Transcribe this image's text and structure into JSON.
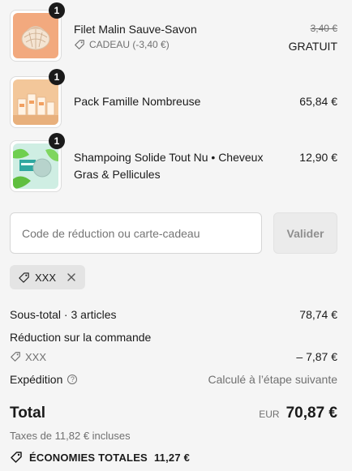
{
  "items": [
    {
      "quantity": "1",
      "name": "Filet Malin Sauve-Savon",
      "discount_label": "CADEAU (-3,40 €)",
      "original_price": "3,40 €",
      "price": "GRATUIT",
      "icon": "tag-icon"
    },
    {
      "quantity": "1",
      "name": "Pack Famille Nombreuse",
      "price": "65,84 €"
    },
    {
      "quantity": "1",
      "name_line1": "Shampoing Solide Tout Nu • Cheveux",
      "name_line2": "Gras & Pellicules",
      "price": "12,90 €"
    }
  ],
  "discount": {
    "placeholder": "Code de réduction ou carte-cadeau",
    "button_label": "Valider",
    "applied_code": "XXX"
  },
  "summary": {
    "subtotal_label": "Sous-total · 3 articles",
    "subtotal_value": "78,74 €",
    "order_discount_label": "Réduction sur la commande",
    "order_discount_code": "XXX",
    "order_discount_value": "– 7,87 €",
    "shipping_label": "Expédition",
    "shipping_value": "Calculé à l’étape suivante",
    "total_label": "Total",
    "currency": "EUR",
    "total_value": "70,87 €",
    "taxes_label": "Taxes de 11,82 € incluses",
    "savings_label": "ÉCONOMIES TOTALES",
    "savings_value": "11,27 €"
  }
}
